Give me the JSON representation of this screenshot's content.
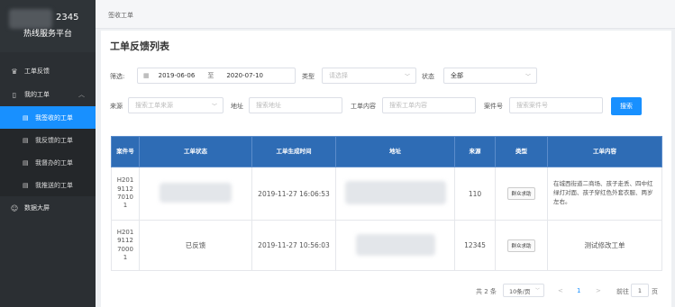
{
  "sidebar": {
    "brand_number": "2345",
    "brand_subtitle": "热线服务平台",
    "items": [
      {
        "label": "工单反馈",
        "icon": "crown-icon"
      },
      {
        "label": "我的工单",
        "icon": "document-icon"
      },
      {
        "label": "我签收的工单",
        "icon": "file-icon",
        "active": true
      },
      {
        "label": "我反馈的工单",
        "icon": "file-icon"
      },
      {
        "label": "我督办的工单",
        "icon": "file-icon"
      },
      {
        "label": "我推送的工单",
        "icon": "file-icon"
      },
      {
        "label": "数据大屏",
        "icon": "user-icon"
      }
    ]
  },
  "breadcrumb": "签收工单",
  "page_title": "工单反馈列表",
  "filters": {
    "date_label": "筛选:",
    "date_start": "2019-06-06",
    "date_to": "至",
    "date_end": "2020-07-10",
    "type_label": "类型",
    "type_placeholder": "请选择",
    "status_label": "状态",
    "status_value": "全部",
    "source_label": "来源",
    "source_placeholder": "搜索工单来源",
    "address_label": "地址",
    "address_placeholder": "搜索地址",
    "content_label": "工单内容",
    "content_placeholder": "搜索工单内容",
    "case_label": "案件号",
    "case_placeholder": "搜索案件号",
    "search_button": "搜索"
  },
  "table": {
    "headers": [
      "案件号",
      "工单状态",
      "工单生成时间",
      "地址",
      "来源",
      "类型",
      "工单内容"
    ],
    "rows": [
      {
        "id": [
          "H201",
          "9112",
          "7010",
          "1"
        ],
        "status": "",
        "time": "2019-11-27 16:06:53",
        "address": "",
        "source": "110",
        "type": "群众求助",
        "content": "在城西街道二商场、孩子走丢、四中红绿灯对面、孩子穿红色外套衣服、两岁左右。"
      },
      {
        "id": [
          "H201",
          "9112",
          "7000",
          "1"
        ],
        "status": "已反馈",
        "time": "2019-11-27 10:56:03",
        "address": "",
        "source": "12345",
        "type": "群众求助",
        "content": "测试修改工单"
      }
    ]
  },
  "pagination": {
    "total": "共 2 条",
    "page_size": "10条/页",
    "prev": "<",
    "current": "1",
    "next": ">",
    "goto_label": "前往",
    "goto_value": "1",
    "page_suffix": "页"
  }
}
